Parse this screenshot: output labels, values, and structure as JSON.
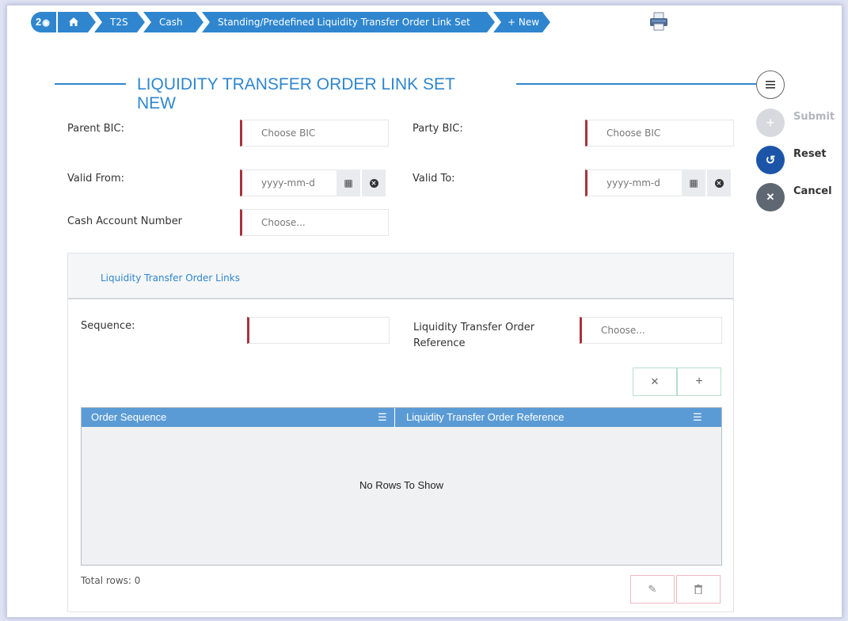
{
  "breadcrumb": {
    "badge_count": "2",
    "items": [
      "T2S",
      "Cash",
      "Standing/Predefined Liquidity Transfer Order Link Set",
      "+ New"
    ]
  },
  "title": {
    "line1": "LIQUIDITY TRANSFER ORDER LINK SET",
    "line2": "NEW"
  },
  "form": {
    "parent_bic_label": "Parent BIC:",
    "parent_bic_placeholder": "Choose BIC",
    "party_bic_label": "Party BIC:",
    "party_bic_placeholder": "Choose BIC",
    "valid_from_label": "Valid From:",
    "valid_from_placeholder": "yyyy-mm-d",
    "valid_to_label": "Valid To:",
    "valid_to_placeholder": "yyyy-mm-d",
    "cash_account_label": "Cash Account Number",
    "cash_account_placeholder": "Choose..."
  },
  "actions": {
    "submit": "Submit",
    "reset": "Reset",
    "cancel": "Cancel"
  },
  "panel": {
    "title": "Liquidity Transfer Order Links",
    "sequence_label": "Sequence:",
    "reference_label_line1": "Liquidity Transfer Order",
    "reference_label_line2": "Reference",
    "reference_placeholder": "Choose...",
    "grid": {
      "columns": [
        "Order Sequence",
        "Liquidity Transfer Order Reference"
      ],
      "empty_text": "No Rows To Show"
    },
    "total_rows": "Total rows: 0"
  },
  "colors": {
    "accent": "#2f86cf",
    "required": "#a8333d",
    "reset": "#1c55a8",
    "grid_header": "#5b9bd5"
  }
}
